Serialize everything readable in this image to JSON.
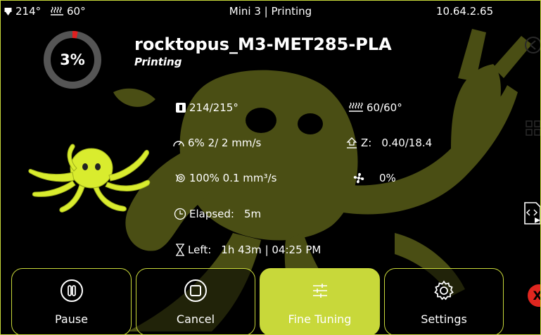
{
  "status_bar": {
    "nozzle_temp": "214°",
    "bed_temp": "60°",
    "title": "Mini 3 | Printing",
    "ip": "10.64.2.65"
  },
  "progress": {
    "percent_label": "3%",
    "fraction": 0.03
  },
  "job": {
    "file_name": "rocktopus_M3-MET285-PLA",
    "state": "Printing"
  },
  "stats": {
    "nozzle": "214/215°",
    "bed": "60/60°",
    "speed": "6%   2/  2 mm/s",
    "z_label": "Z:",
    "z_value": "0.40/18.4",
    "flow": "100%   0.1 mm³/s",
    "fan": "0%",
    "elapsed_label": "Elapsed:",
    "elapsed_value": "5m",
    "left_label": "Left:",
    "left_value": "1h 43m   | 04:25 PM"
  },
  "buttons": {
    "pause": "Pause",
    "cancel": "Cancel",
    "fine_tuning": "Fine Tuning",
    "settings": "Settings"
  },
  "side": {
    "close_glyph": "X"
  },
  "colors": {
    "accent": "#c8d83a",
    "background": "#000000",
    "logo_bg": "#4a4e14",
    "ring_track": "#555555",
    "ring_progress": "#e02020",
    "close_red": "#e0261f"
  },
  "icons": [
    "home-icon",
    "nozzle-icon",
    "bed-heater-icon",
    "speedometer-icon",
    "z-axis-icon",
    "flow-icon",
    "fan-icon",
    "clock-icon",
    "hourglass-icon",
    "pause-icon",
    "stop-icon",
    "sliders-icon",
    "gear-icon",
    "back-icon",
    "grid-icon",
    "console-icon",
    "close-icon"
  ]
}
